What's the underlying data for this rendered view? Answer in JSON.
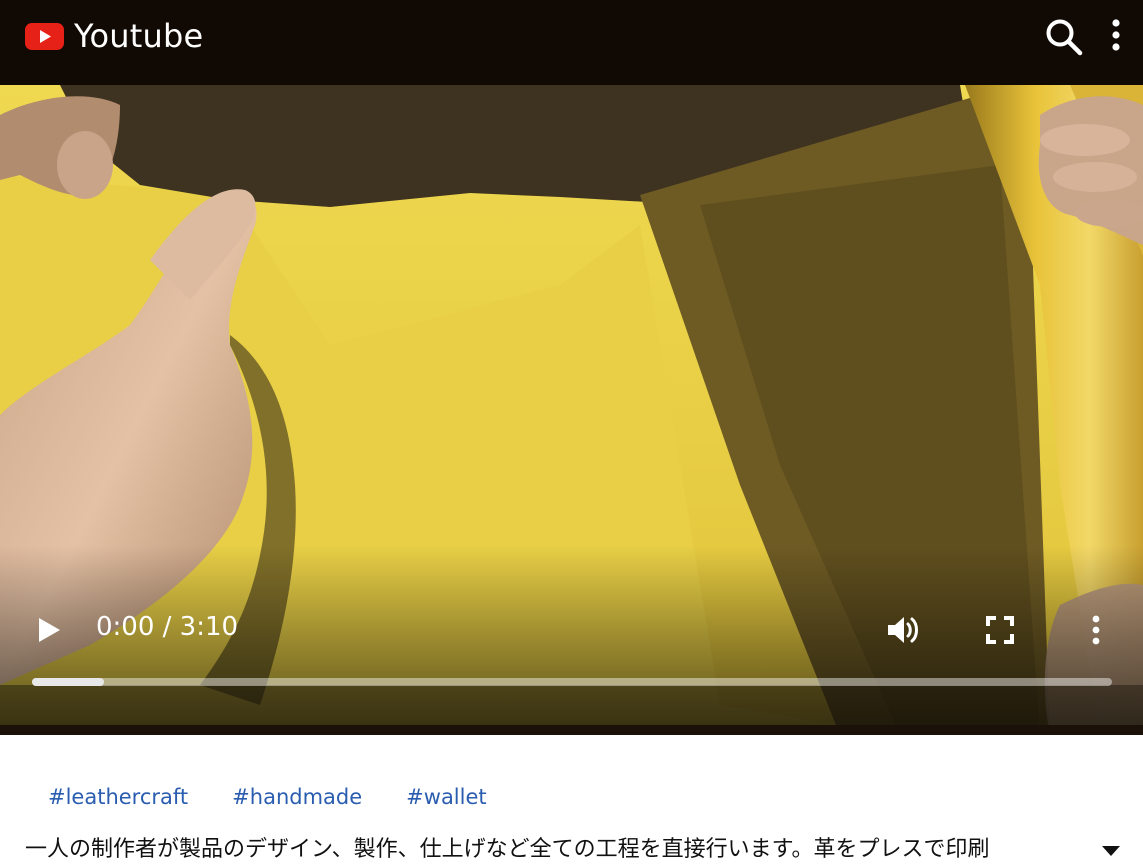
{
  "header": {
    "app_title": "Youtube",
    "logo_icon": "youtube-play-logo-icon",
    "search_icon": "search-icon",
    "menu_icon": "more-vert-icon",
    "brand_color": "#e62117",
    "background_color": "#110a04"
  },
  "player": {
    "time": "0:00 / 3:10",
    "progress": 0.067,
    "play_icon": "play-icon",
    "volume_icon": "volume-icon",
    "fullscreen_icon": "fullscreen-icon",
    "menu_icon": "more-vert-icon"
  },
  "hashtags": [
    "#leathercraft",
    "#handmade",
    "#wallet"
  ],
  "description": {
    "text": "一人の制作者が製品のデザイン、製作、仕上げなど全ての工程を直接行います。革をプレスで印刷",
    "expand_icon": "caret-down-icon"
  },
  "colors": {
    "link": "#2a5db0",
    "text": "#111111"
  }
}
